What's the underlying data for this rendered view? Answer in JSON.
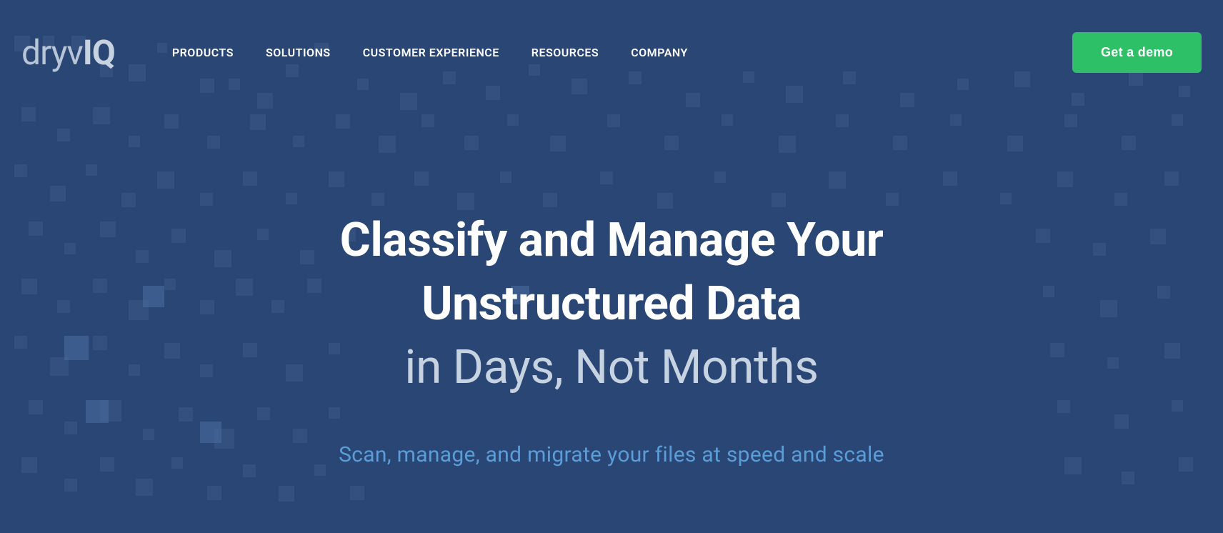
{
  "logo": {
    "part1": "dryv",
    "part2": "IQ"
  },
  "nav": {
    "items": [
      {
        "label": "PRODUCTS"
      },
      {
        "label": "SOLUTIONS"
      },
      {
        "label": "CUSTOMER EXPERIENCE"
      },
      {
        "label": "RESOURCES"
      },
      {
        "label": "COMPANY"
      }
    ]
  },
  "cta": {
    "label": "Get a demo"
  },
  "hero": {
    "heading_line1": "Classify and Manage Your",
    "heading_line2": "Unstructured Data",
    "heading_line3": "in Days, Not Months",
    "subheading": "Scan, manage, and migrate your files at speed and scale"
  },
  "colors": {
    "background": "#2a4674",
    "cta_bg": "#2ec066",
    "text_primary": "#ffffff",
    "text_secondary": "#c8d3e2",
    "text_accent": "#5a9dd8"
  }
}
